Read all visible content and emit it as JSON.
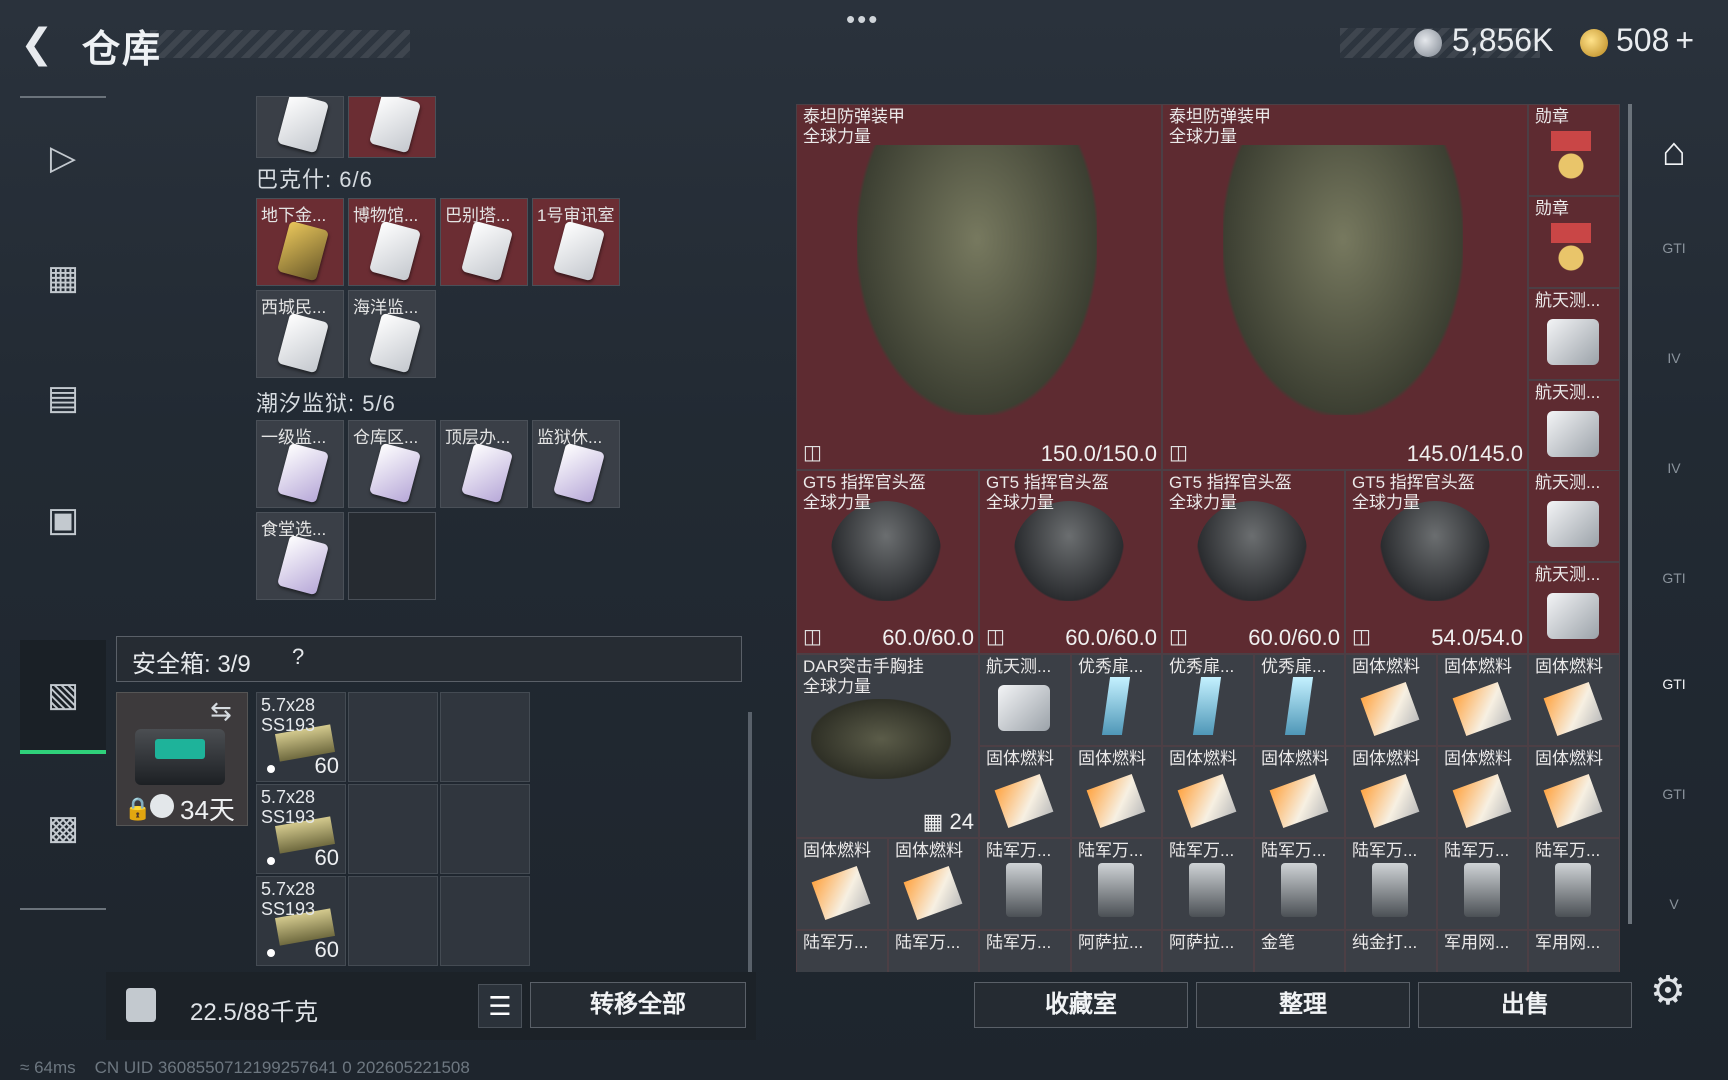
{
  "header": {
    "back_icon": "back-arrow-icon",
    "title": "仓库",
    "dots": "•••",
    "money": "5,856K",
    "bonds": "508",
    "plus": "+"
  },
  "left_nav": [
    "gun-icon",
    "vest-icon",
    "backpack-icon",
    "pouch-icon",
    "safe-icon",
    "briefcase-icon"
  ],
  "stash": {
    "top_partial": [
      "",
      ""
    ],
    "sections": [
      {
        "name": "巴克什: 6/6",
        "cells": [
          "地下金...",
          "博物馆...",
          "巴别塔...",
          "1号审讯室",
          "西城民...",
          "海洋监..."
        ]
      },
      {
        "name": "潮汐监狱: 5/6",
        "cells": [
          "一级监...",
          "仓库区...",
          "顶层办...",
          "监狱休...",
          "食堂选..."
        ]
      }
    ]
  },
  "safe": {
    "label": "安全箱: 3/9",
    "help": "?",
    "days": "34天",
    "ammo": [
      {
        "name": "5.7x28",
        "sub": "SS193",
        "qty": "60"
      },
      {
        "name": "5.7x28",
        "sub": "SS193",
        "qty": "60"
      },
      {
        "name": "5.7x28",
        "sub": "SS193",
        "qty": "60"
      }
    ]
  },
  "bottom_left": {
    "weight": "22.5/88千克",
    "transfer_all": "转移全部"
  },
  "grid": {
    "armor": [
      {
        "name": "泰坦防弹装甲",
        "brand": "全球力量",
        "durability": "150.0/150.0"
      },
      {
        "name": "泰坦防弹装甲",
        "brand": "全球力量",
        "durability": "145.0/145.0"
      }
    ],
    "side_col": [
      "勋章",
      "勋章",
      "航天测...",
      "航天测...",
      "航天测...",
      "航天测..."
    ],
    "helmets": [
      {
        "name": "GT5 指挥官头盔",
        "brand": "全球力量",
        "durability": "60.0/60.0"
      },
      {
        "name": "GT5 指挥官头盔",
        "brand": "全球力量",
        "durability": "60.0/60.0"
      },
      {
        "name": "GT5 指挥官头盔",
        "brand": "全球力量",
        "durability": "60.0/60.0"
      },
      {
        "name": "GT5 指挥官头盔",
        "brand": "全球力量",
        "durability": "54.0/54.0"
      }
    ],
    "rig": {
      "name": "DAR突击手胸挂",
      "brand": "全球力量",
      "count": "24"
    },
    "row1": [
      "航天测...",
      "优秀扉...",
      "优秀扉...",
      "优秀扉...",
      "固体燃料",
      "固体燃料",
      "固体燃料"
    ],
    "row2": [
      "固体燃料",
      "固体燃料",
      "固体燃料",
      "固体燃料",
      "固体燃料",
      "固体燃料",
      "固体燃料"
    ],
    "row3": [
      "固体燃料",
      "固体燃料",
      "陆军万...",
      "陆军万...",
      "陆军万...",
      "陆军万...",
      "陆军万...",
      "陆军万...",
      "陆军万..."
    ],
    "row4": [
      "陆军万...",
      "陆军万...",
      "陆军万...",
      "阿萨拉...",
      "阿萨拉...",
      "金笔",
      "纯金打...",
      "军用网...",
      "军用网..."
    ]
  },
  "bottom_right": {
    "collection": "收藏室",
    "sort": "整理",
    "sell": "出售"
  },
  "right_nav": [
    "GTI",
    "IV",
    "IV",
    "GTI",
    "GTI",
    "GTI",
    "V"
  ],
  "footer": {
    "ping": "64ms",
    "uid": "CN UID 3608550712199257641 0 202605221508"
  }
}
